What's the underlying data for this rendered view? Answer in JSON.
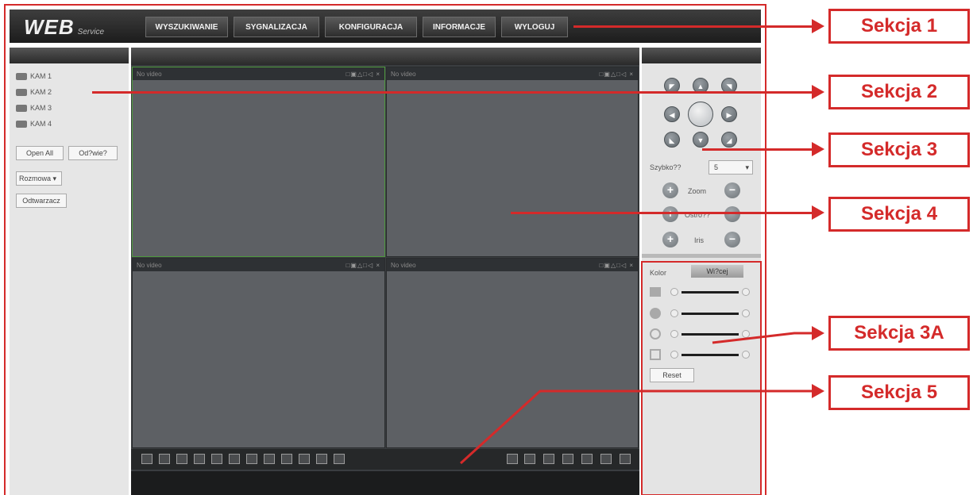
{
  "logo": {
    "main": "WEB",
    "sub": "Service"
  },
  "nav": [
    {
      "label": "WYSZUKIWANIE"
    },
    {
      "label": "SYGNALIZACJA"
    },
    {
      "label": "KONFIGURACJA"
    },
    {
      "label": "INFORMACJE"
    },
    {
      "label": "WYLOGUJ"
    }
  ],
  "cameras": [
    "KAM 1",
    "KAM 2",
    "KAM 3",
    "KAM 4"
  ],
  "left_panel": {
    "open_all": "Open All",
    "refresh": "Od?wie?",
    "stream_select": "Rozmowa",
    "player": "Odtwarzacz"
  },
  "panes": [
    {
      "label": "No video",
      "active": true
    },
    {
      "label": "No video",
      "active": false
    },
    {
      "label": "No video",
      "active": false
    },
    {
      "label": "No video",
      "active": false
    }
  ],
  "pane_icons": "□▣△□◁ ×",
  "ptz": {
    "speed_label": "Szybko??",
    "speed_value": "5",
    "zoom_label": "Zoom",
    "focus_label": "Ostro??",
    "iris_label": "Iris"
  },
  "color_tabs": {
    "tab1": "Kolor",
    "tab2": "Wi?cej"
  },
  "reset": "Reset",
  "annotations": [
    "Sekcja 1",
    "Sekcja 2",
    "Sekcja 3",
    "Sekcja 4",
    "Sekcja 3A",
    "Sekcja 5"
  ],
  "colors": {
    "annotation_red": "#d42a2a",
    "active_pane_border": "#4e9a3e",
    "bar_dark": "#2a2a2a"
  }
}
